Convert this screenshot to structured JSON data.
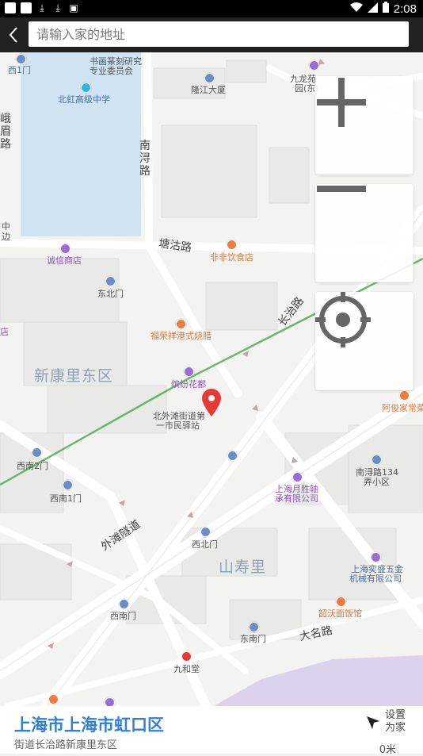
{
  "status_bar": {
    "time": "2:08"
  },
  "search": {
    "placeholder": "请输入家的地址",
    "value": ""
  },
  "map": {
    "labels": {
      "xishan1men": "西1门",
      "calligraphy_assoc_1": "书画篆刻研究",
      "calligraphy_assoc_2": "专业委员会",
      "beihong_school": "北虹高级中学",
      "longjiang_building": "隆江大厦",
      "jiulong_garden_1": "九龙苑",
      "jiulong_garden_2": "园(东)",
      "emei_road": "峨眉路",
      "nanxun_road": "南浔路",
      "tanggu_road": "塘沽路",
      "feifei_restaurant": "非非饮食店",
      "chengxin_shop": "诚信商店",
      "dongbei_men": "东北门",
      "fu_rong_xiang": "福荣祥港式烧腊",
      "changzhi_road": "长治路",
      "xinkangli_east": "新康里东区",
      "binfen_garden": "缤纷花都",
      "bei_waitan_1": "北外滩街道第",
      "bei_waitan_2": "一市民驿站",
      "afu_home": "阿俊家常菜",
      "xinan_2men": "西南2门",
      "xinan_1men": "西南1门",
      "yuesheng_1": "上海月胜轴",
      "yuesheng_2": "承有限公司",
      "nanxun_134_1": "南浔路134",
      "nanxun_134_2": "弄小区",
      "waitan_tunnel": "外滩隧道",
      "xibei_men": "西北门",
      "shanshou_li": "山寿里",
      "yisheng_1": "上海奕盛五金",
      "yisheng_2": "机械有限公司",
      "xinan_men": "西南门",
      "shaowo_restaurant": "韶沃面饭馆",
      "dongnan_men": "东南门",
      "daming_road": "大名路",
      "jiuhe_tang": "九和堂",
      "left_edge_1": "中",
      "left_edge_2": "边",
      "left_edge_3": "店"
    }
  },
  "colors": {
    "accent": "#2f7fd8",
    "pin": "#e53935",
    "metro_line": "#4caf50",
    "water": "#cfe3f3",
    "park": "#ddd2ee"
  },
  "icons": {
    "zoom_in": "plus-icon",
    "zoom_out": "minus-icon",
    "locate": "crosshair-icon",
    "set_home": "cursor-arrow-icon",
    "back": "chevron-left-icon"
  },
  "bottom": {
    "title": "上海市上海市虹口区",
    "subtitle": "街道长治路新康里东区",
    "set_home_label_1": "设置",
    "set_home_label_2": "为家",
    "distance": "0米"
  }
}
